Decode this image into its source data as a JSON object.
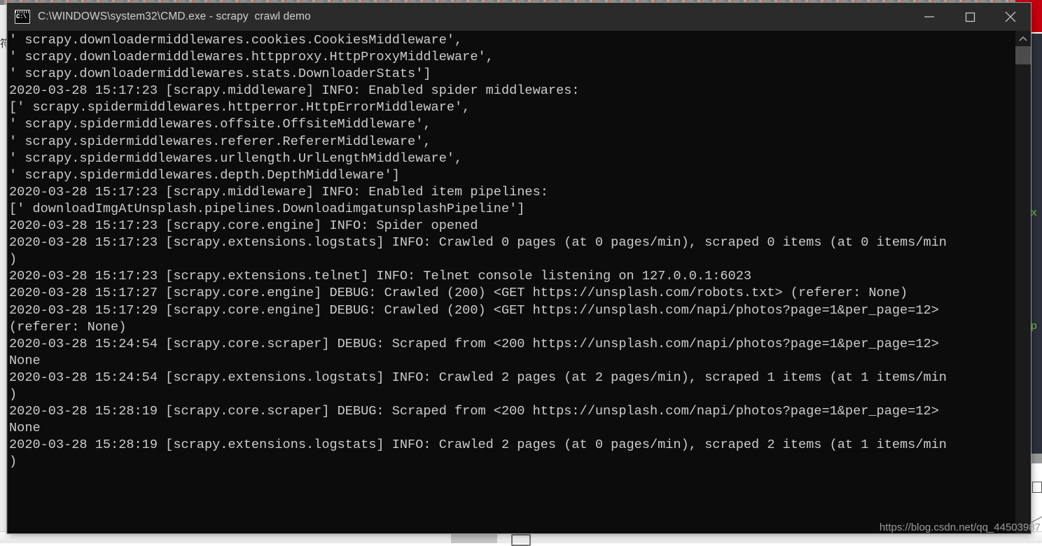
{
  "window": {
    "title": "C:\\WINDOWS\\system32\\CMD.exe - scrapy  crawl demo",
    "icon_label": "C:\\",
    "minimize_label": "Minimize",
    "maximize_label": "Maximize",
    "close_label": "Close",
    "background_color": "#0c0c0c",
    "titlebar_color": "#2b2b2b",
    "text_color": "#cccccc"
  },
  "console": {
    "lines": [
      "' scrapy.downloadermiddlewares.cookies.CookiesMiddleware',",
      "' scrapy.downloadermiddlewares.httpproxy.HttpProxyMiddleware',",
      "' scrapy.downloadermiddlewares.stats.DownloaderStats']",
      "2020-03-28 15:17:23 [scrapy.middleware] INFO: Enabled spider middlewares:",
      "[' scrapy.spidermiddlewares.httperror.HttpErrorMiddleware',",
      "' scrapy.spidermiddlewares.offsite.OffsiteMiddleware',",
      "' scrapy.spidermiddlewares.referer.RefererMiddleware',",
      "' scrapy.spidermiddlewares.urllength.UrlLengthMiddleware',",
      "' scrapy.spidermiddlewares.depth.DepthMiddleware']",
      "2020-03-28 15:17:23 [scrapy.middleware] INFO: Enabled item pipelines:",
      "[' downloadImgAtUnsplash.pipelines.DownloadimgatunsplashPipeline']",
      "2020-03-28 15:17:23 [scrapy.core.engine] INFO: Spider opened",
      "2020-03-28 15:17:23 [scrapy.extensions.logstats] INFO: Crawled 0 pages (at 0 pages/min), scraped 0 items (at 0 items/min",
      ")",
      "2020-03-28 15:17:23 [scrapy.extensions.telnet] INFO: Telnet console listening on 127.0.0.1:6023",
      "2020-03-28 15:17:27 [scrapy.core.engine] DEBUG: Crawled (200) <GET https://unsplash.com/robots.txt> (referer: None)",
      "2020-03-28 15:17:29 [scrapy.core.engine] DEBUG: Crawled (200) <GET https://unsplash.com/napi/photos?page=1&per_page=12>",
      "(referer: None)",
      "2020-03-28 15:24:54 [scrapy.core.scraper] DEBUG: Scraped from <200 https://unsplash.com/napi/photos?page=1&per_page=12>",
      "None",
      "2020-03-28 15:24:54 [scrapy.extensions.logstats] INFO: Crawled 2 pages (at 2 pages/min), scraped 1 items (at 1 items/min",
      ")",
      "2020-03-28 15:28:19 [scrapy.core.scraper] DEBUG: Scraped from <200 https://unsplash.com/napi/photos?page=1&per_page=12>",
      "None",
      "2020-03-28 15:28:19 [scrapy.extensions.logstats] INFO: Crawled 2 pages (at 0 pages/min), scraped 2 items (at 1 items/min",
      ")"
    ]
  },
  "scrollbar": {
    "up_arrow": "scroll-up",
    "thumb": "scroll-thumb"
  },
  "background": {
    "left_column_text": "符是扫好n"
  },
  "watermark": {
    "text": "https://blog.csdn.net/qq_44503987"
  }
}
